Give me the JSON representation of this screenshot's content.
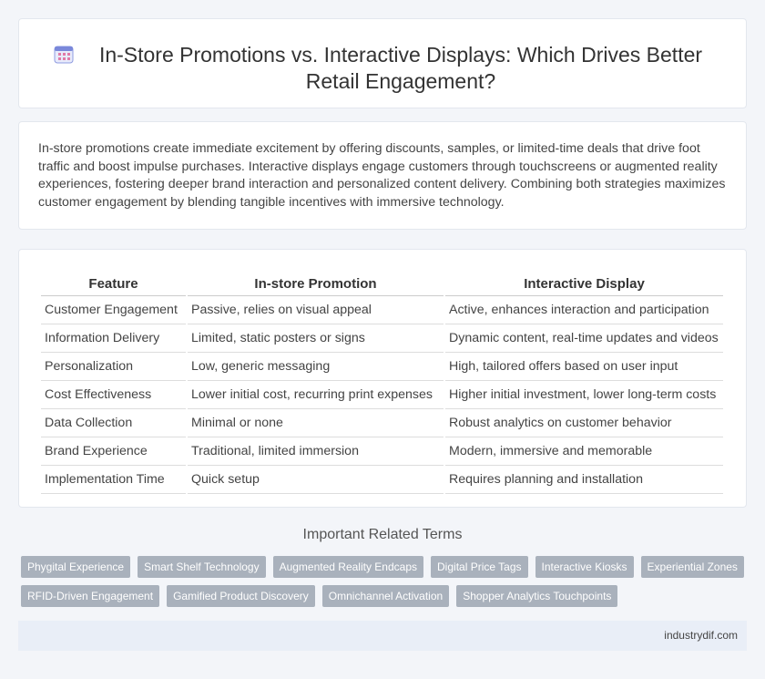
{
  "header": {
    "title": "In-Store Promotions vs. Interactive Displays: Which Drives Better Retail Engagement?",
    "icon": "calendar-icon"
  },
  "intro": {
    "text": "In-store promotions create immediate excitement by offering discounts, samples, or limited-time deals that drive foot traffic and boost impulse purchases. Interactive displays engage customers through touchscreens or augmented reality experiences, fostering deeper brand interaction and personalized content delivery. Combining both strategies maximizes customer engagement by blending tangible incentives with immersive technology."
  },
  "table": {
    "headers": [
      "Feature",
      "In-store Promotion",
      "Interactive Display"
    ],
    "rows": [
      [
        "Customer Engagement",
        "Passive, relies on visual appeal",
        "Active, enhances interaction and participation"
      ],
      [
        "Information Delivery",
        "Limited, static posters or signs",
        "Dynamic content, real-time updates and videos"
      ],
      [
        "Personalization",
        "Low, generic messaging",
        "High, tailored offers based on user input"
      ],
      [
        "Cost Effectiveness",
        "Lower initial cost, recurring print expenses",
        "Higher initial investment, lower long-term costs"
      ],
      [
        "Data Collection",
        "Minimal or none",
        "Robust analytics on customer behavior"
      ],
      [
        "Brand Experience",
        "Traditional, limited immersion",
        "Modern, immersive and memorable"
      ],
      [
        "Implementation Time",
        "Quick setup",
        "Requires planning and installation"
      ]
    ]
  },
  "related": {
    "heading": "Important Related Terms",
    "tags": [
      "Phygital Experience",
      "Smart Shelf Technology",
      "Augmented Reality Endcaps",
      "Digital Price Tags",
      "Interactive Kiosks",
      "Experiential Zones",
      "RFID-Driven Engagement",
      "Gamified Product Discovery",
      "Omnichannel Activation",
      "Shopper Analytics Touchpoints"
    ]
  },
  "footer": {
    "site": "industrydif.com"
  },
  "colors": {
    "accent": "#6b7bd6",
    "tag_bg": "#a9b1bc",
    "footer_bg": "#e9eef7"
  }
}
